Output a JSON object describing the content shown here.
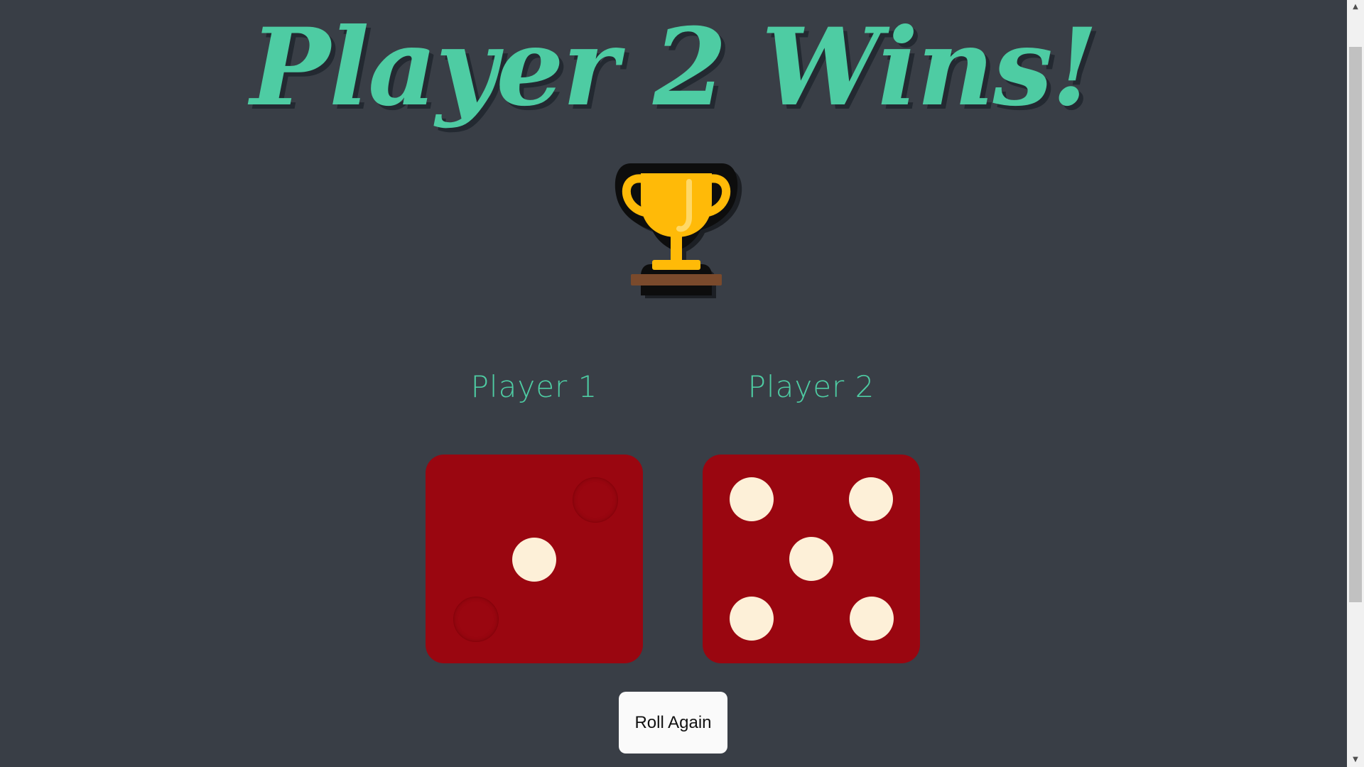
{
  "title": "Player 2 Wins!",
  "trophy": {
    "icon": "trophy-icon",
    "cup_color": "#ffba08",
    "base_color": "#7a4a2c"
  },
  "players": [
    {
      "label": "Player 1",
      "die_value": 1
    },
    {
      "label": "Player 2",
      "die_value": 5
    }
  ],
  "colors": {
    "background": "#393e46",
    "accent": "#4ecca3",
    "die": "#9a0610",
    "pip": "#fdf0d8"
  },
  "roll_button": {
    "label": "Roll Again"
  }
}
